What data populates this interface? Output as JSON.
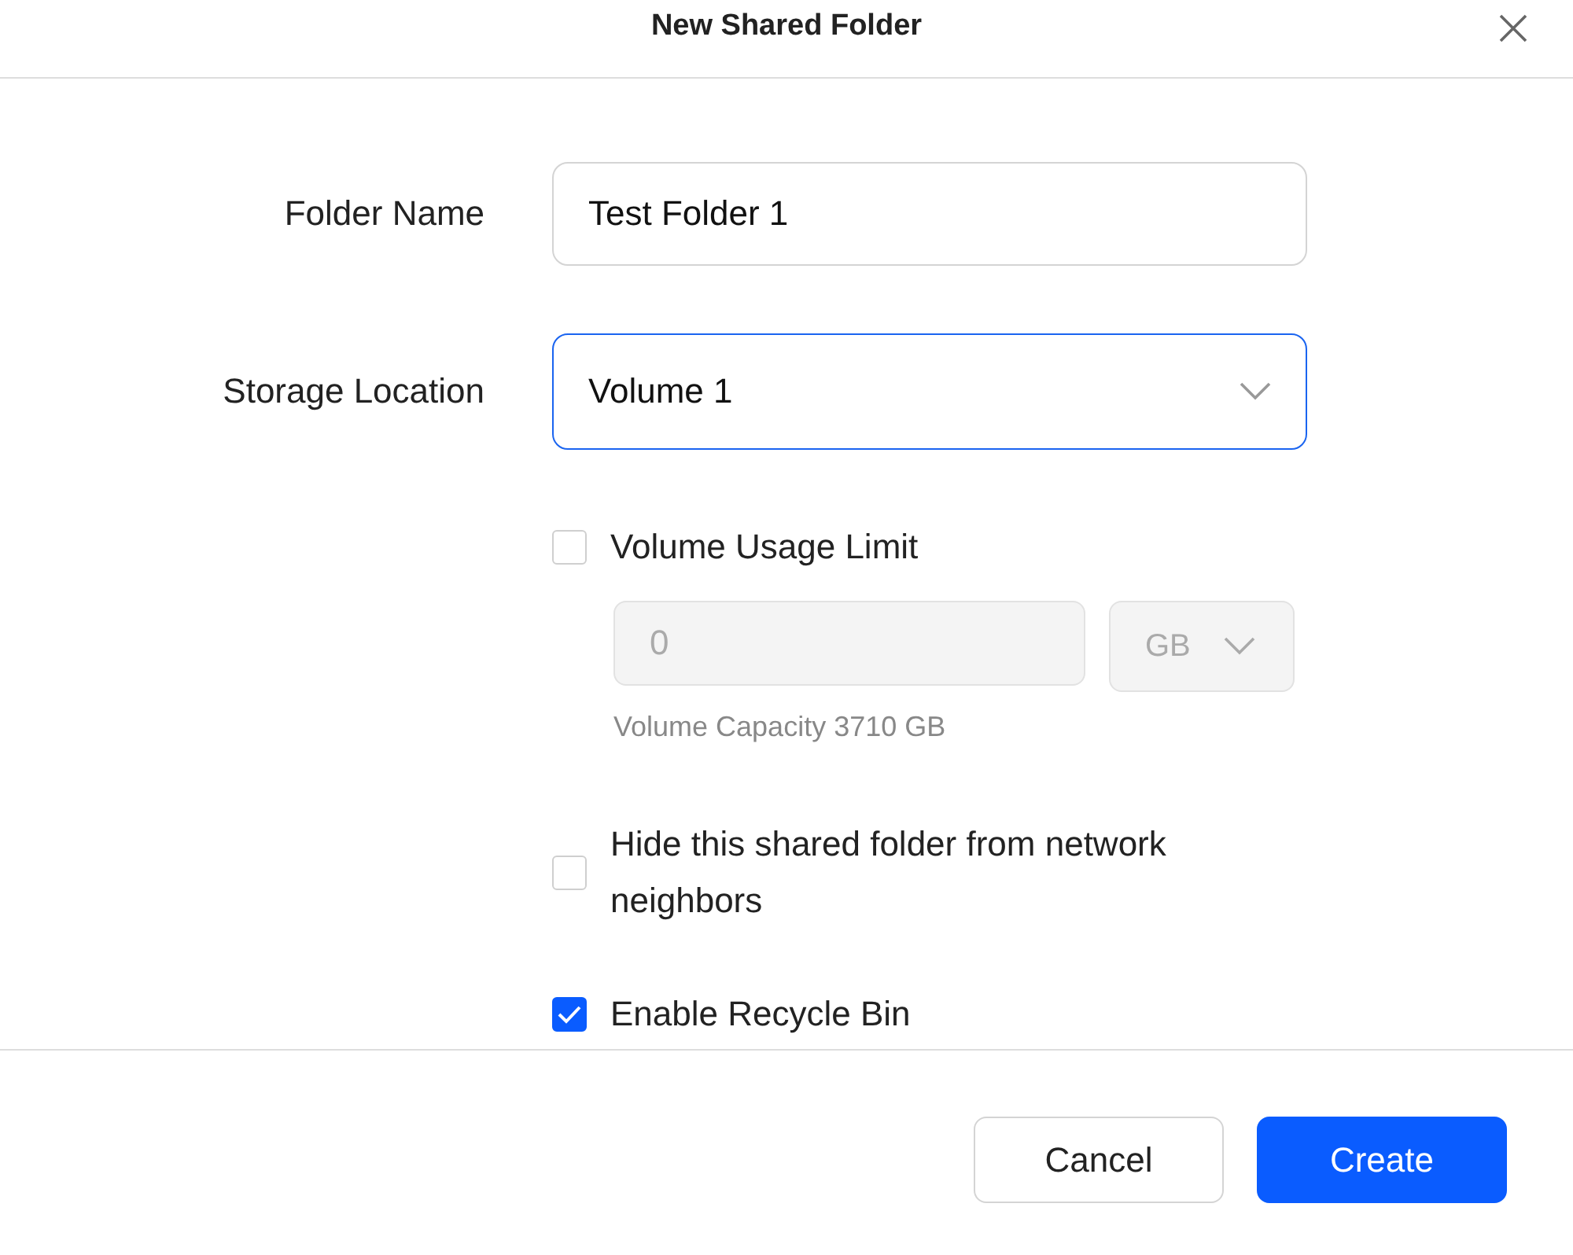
{
  "dialog": {
    "title": "New Shared Folder"
  },
  "fields": [
    {
      "label": "Folder Name",
      "kind": "text",
      "value": "Test Folder 1",
      "focused": false
    },
    {
      "label": "Storage Location",
      "kind": "select",
      "value": "Volume 1",
      "focused": true
    }
  ],
  "usage_limit": {
    "label": "Volume Usage Limit",
    "checked": false,
    "amount": {
      "value": "0",
      "disabled": true
    },
    "unit": {
      "value": "GB",
      "disabled": true
    },
    "hint": "Volume Capacity 3710 GB"
  },
  "options": [
    {
      "label": "Hide this shared folder from network neighbors",
      "checked": false
    },
    {
      "label": "Enable Recycle Bin",
      "checked": true
    }
  ],
  "buttons": [
    {
      "label": "Cancel",
      "kind": "secondary"
    },
    {
      "label": "Create",
      "kind": "primary"
    }
  ]
}
